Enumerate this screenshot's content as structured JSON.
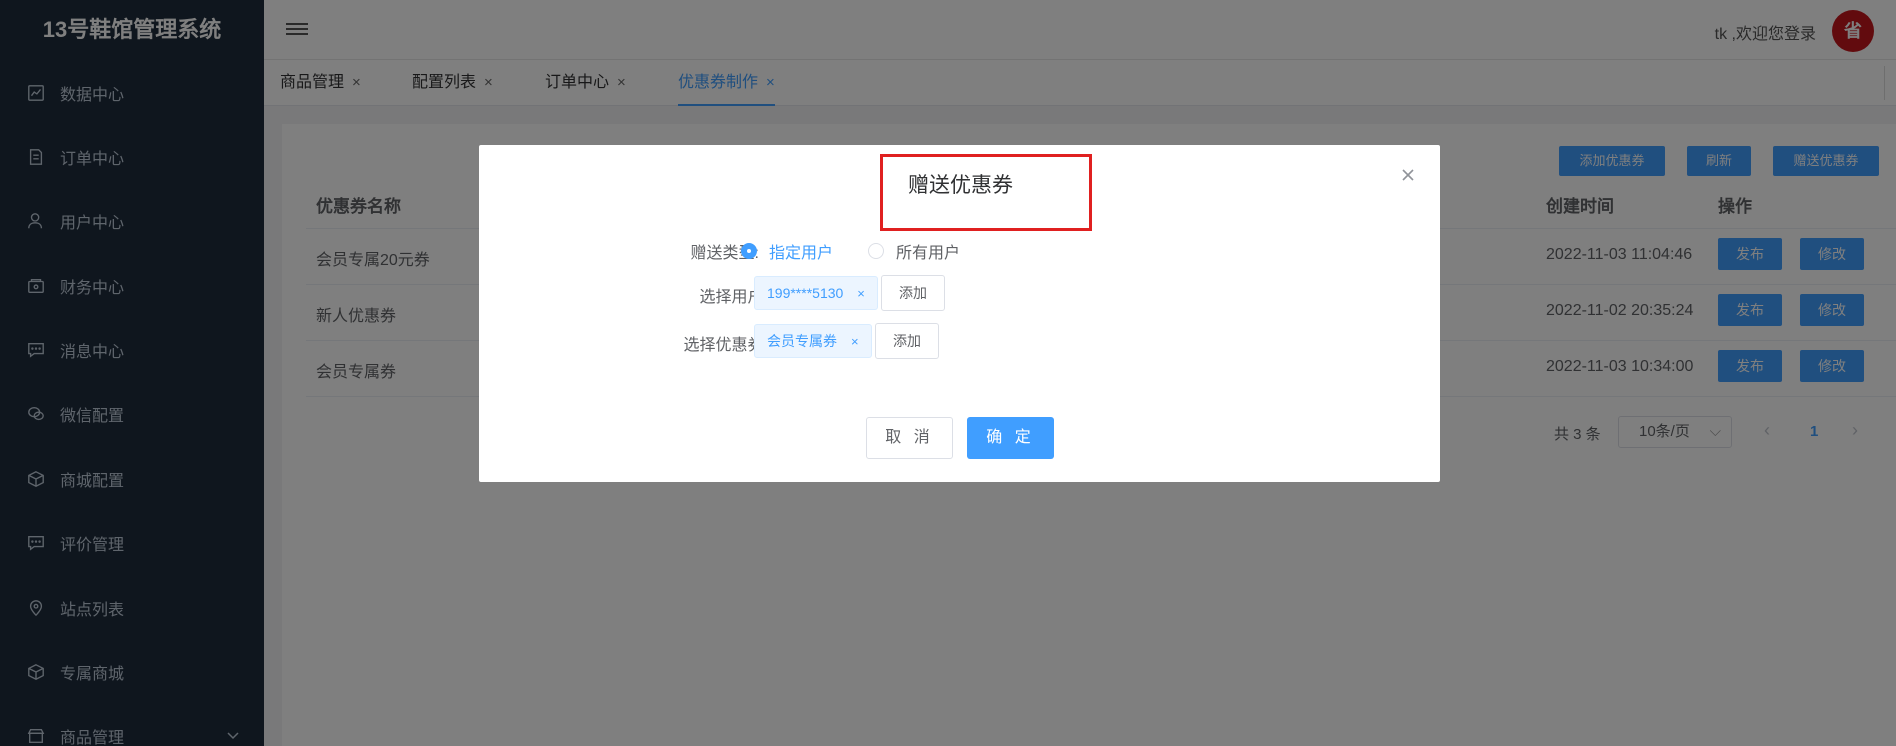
{
  "app": {
    "title": "13号鞋馆管理系统"
  },
  "sidebar": {
    "items": [
      {
        "label": "数据中心",
        "icon": "chart-icon"
      },
      {
        "label": "订单中心",
        "icon": "document-icon"
      },
      {
        "label": "用户中心",
        "icon": "user-icon"
      },
      {
        "label": "财务中心",
        "icon": "wallet-icon"
      },
      {
        "label": "消息中心",
        "icon": "message-icon"
      },
      {
        "label": "微信配置",
        "icon": "wechat-icon"
      },
      {
        "label": "商城配置",
        "icon": "box-icon"
      },
      {
        "label": "评价管理",
        "icon": "comment-icon"
      },
      {
        "label": "站点列表",
        "icon": "location-icon"
      },
      {
        "label": "专属商城",
        "icon": "box-icon"
      },
      {
        "label": "商品管理",
        "icon": "shop-icon"
      }
    ]
  },
  "header": {
    "welcome": "tk ,欢迎您登录",
    "avatar_text": "省"
  },
  "tabs": [
    {
      "label": "商品管理",
      "close": "×"
    },
    {
      "label": "配置列表",
      "close": "×"
    },
    {
      "label": "订单中心",
      "close": "×"
    },
    {
      "label": "优惠券制作",
      "close": "×"
    }
  ],
  "toolbar": {
    "add": "添加优惠券",
    "refresh": "刷新",
    "gift": "赠送优惠券"
  },
  "table": {
    "headers": {
      "name": "优惠券名称",
      "created": "创建时间",
      "actions": "操作"
    },
    "rows": [
      {
        "name": "会员专属20元券",
        "created": "2022-11-03 11:04:46",
        "publish": "发布",
        "edit": "修改"
      },
      {
        "name": "新人优惠券",
        "created": "2022-11-02 20:35:24",
        "publish": "发布",
        "edit": "修改"
      },
      {
        "name": "会员专属券",
        "created": "2022-11-03 10:34:00",
        "publish": "发布",
        "edit": "修改"
      }
    ]
  },
  "pager": {
    "total": "共 3 条",
    "page_size": "10条/页",
    "prev": "‹",
    "next": "›",
    "current": "1"
  },
  "dialog": {
    "title": "赠送优惠券",
    "gift_type_label": "赠送类型:",
    "radio_specific": "指定用户",
    "radio_all": "所有用户",
    "select_user_label": "选择用户:",
    "user_tag": "199****5130",
    "select_coupon_label": "选择优惠券:",
    "coupon_tag": "会员专属券",
    "tag_close": "×",
    "add": "添加",
    "cancel": "取 消",
    "confirm": "确 定"
  }
}
